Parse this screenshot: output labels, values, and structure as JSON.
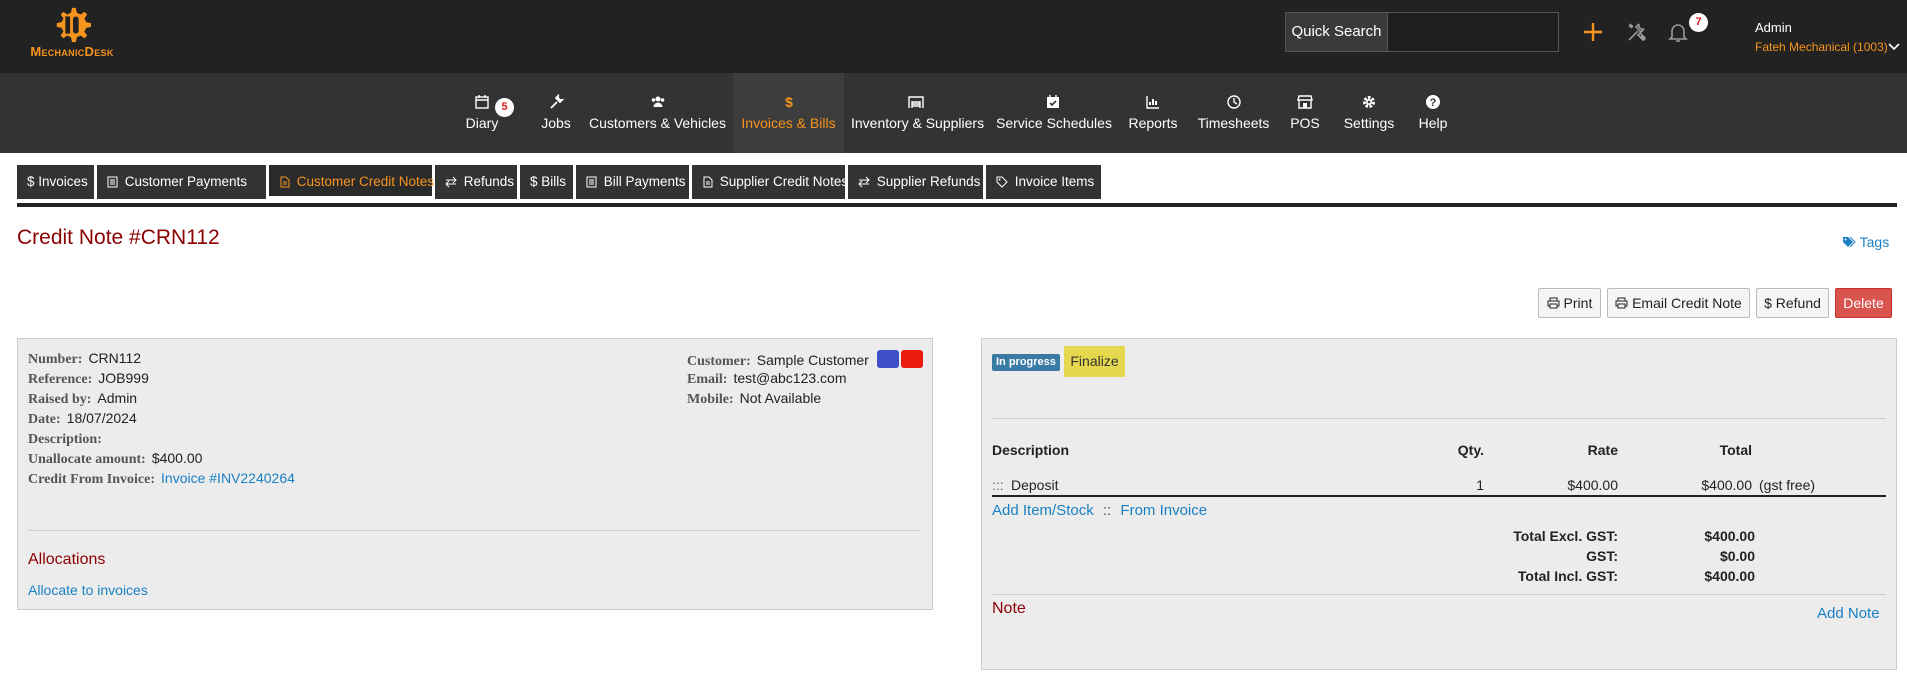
{
  "brand": {
    "name": "MechanicDesk",
    "accent": "#f7941d"
  },
  "topbar": {
    "quick_search_label": "Quick Search",
    "quick_search_value": "",
    "notifications_count": "7",
    "user_name": "Admin",
    "company": "Fateh Mechanical (1003)"
  },
  "nav": {
    "diary": {
      "label": "Diary",
      "badge": "5"
    },
    "jobs": "Jobs",
    "customers_vehicles": "Customers & Vehicles",
    "invoices_bills": "Invoices & Bills",
    "inventory_suppliers": "Inventory & Suppliers",
    "service_schedules": "Service Schedules",
    "reports": "Reports",
    "timesheets": "Timesheets",
    "pos": "POS",
    "settings": "Settings",
    "help": "Help"
  },
  "subtabs": {
    "invoices": "Invoices",
    "customer_payments": "Customer Payments",
    "customer_credit_notes": "Customer Credit Notes",
    "refunds": "Refunds",
    "bills": "Bills",
    "bill_payments": "Bill Payments",
    "supplier_credit_notes": "Supplier Credit Notes",
    "supplier_refunds": "Supplier Refunds",
    "invoice_items": "Invoice Items"
  },
  "page": {
    "title": "Credit Note #CRN112",
    "tags_label": "Tags",
    "actions": {
      "print": "Print",
      "email": "Email Credit Note",
      "refund": "Refund",
      "delete": "Delete"
    }
  },
  "details": {
    "number": {
      "key": "Number:",
      "value": "CRN112"
    },
    "reference": {
      "key": "Reference:",
      "value": "JOB999"
    },
    "raised_by": {
      "key": "Raised by:",
      "value": "Admin"
    },
    "date": {
      "key": "Date:",
      "value": "18/07/2024"
    },
    "description": {
      "key": "Description:",
      "value": ""
    },
    "unallocate": {
      "key": "Unallocate amount:",
      "value": "$400.00"
    },
    "credit_from": {
      "key": "Credit From Invoice:",
      "value": "Invoice #INV2240264"
    },
    "customer": {
      "key": "Customer:",
      "value": "Sample Customer"
    },
    "email": {
      "key": "Email:",
      "value": "test@abc123.com"
    },
    "mobile": {
      "key": "Mobile:",
      "value": "Not Available"
    },
    "swatch_colors": [
      "#3e4fc7",
      "#e81b0c"
    ]
  },
  "allocations": {
    "title": "Allocations",
    "link": "Allocate to invoices"
  },
  "items_panel": {
    "status": "In progress",
    "finalize": "Finalize",
    "columns": {
      "description": "Description",
      "qty": "Qty.",
      "rate": "Rate",
      "total": "Total"
    },
    "rows": [
      {
        "handle": ":::",
        "description": "Deposit",
        "qty": "1",
        "rate": "$400.00",
        "total": "$400.00",
        "tax_note": "(gst free)"
      }
    ],
    "add_item": "Add Item/Stock",
    "separator": "::",
    "from_invoice": "From Invoice",
    "totals": {
      "excl_label": "Total Excl. GST:",
      "excl_value": "$400.00",
      "gst_label": "GST:",
      "gst_value": "$0.00",
      "incl_label": "Total Incl. GST:",
      "incl_value": "$400.00"
    },
    "note_title": "Note",
    "add_note": "Add Note"
  }
}
